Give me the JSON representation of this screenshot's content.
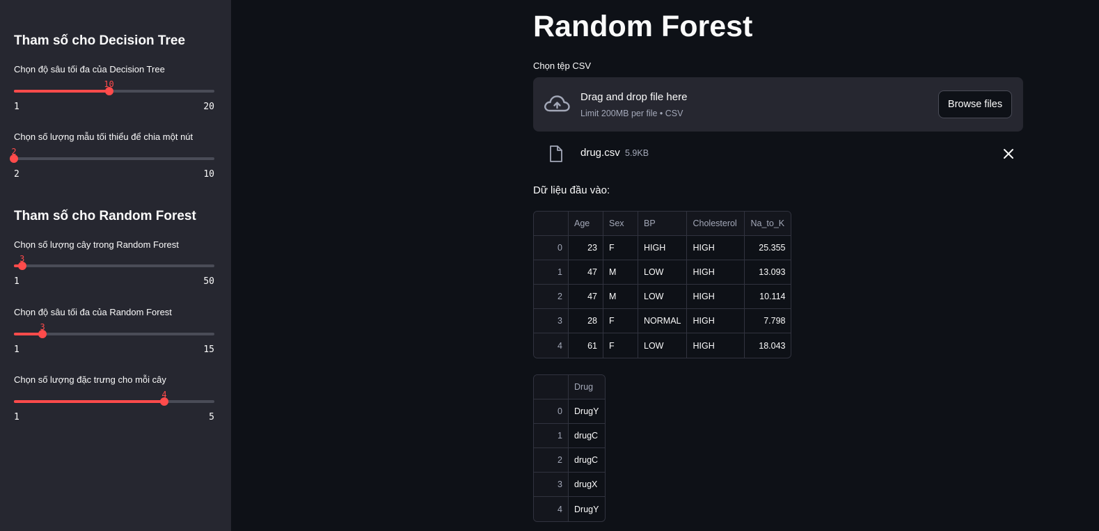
{
  "sidebar": {
    "dt_header": "Tham số cho Decision Tree",
    "rf_header": "Tham số cho Random Forest",
    "sliders": [
      {
        "label": "Chọn độ sâu tối đa của Decision Tree",
        "value": "10",
        "min": "1",
        "max": "20"
      },
      {
        "label": "Chọn số lượng mẫu tối thiểu để chia một nút",
        "value": "2",
        "min": "2",
        "max": "10"
      },
      {
        "label": "Chọn số lượng cây trong Random Forest",
        "value": "3",
        "min": "1",
        "max": "50"
      },
      {
        "label": "Chọn độ sâu tối đa của Random Forest",
        "value": "3",
        "min": "1",
        "max": "15"
      },
      {
        "label": "Chọn số lượng đặc trưng cho mỗi cây",
        "value": "4",
        "min": "1",
        "max": "5"
      }
    ]
  },
  "main": {
    "title": "Random Forest",
    "uploader": {
      "label": "Chọn tệp CSV",
      "drop_text": "Drag and drop file here",
      "limit_text": "Limit 200MB per file • CSV",
      "browse_label": "Browse files"
    },
    "file": {
      "name": "drug.csv",
      "size": "5.9KB"
    },
    "input_label": "Dữ liệu đầu vào:",
    "table_x": {
      "columns": [
        "",
        "Age",
        "Sex",
        "BP",
        "Cholesterol",
        "Na_to_K"
      ],
      "rows": [
        [
          "0",
          "23",
          "F",
          "HIGH",
          "HIGH",
          "25.355"
        ],
        [
          "1",
          "47",
          "M",
          "LOW",
          "HIGH",
          "13.093"
        ],
        [
          "2",
          "47",
          "M",
          "LOW",
          "HIGH",
          "10.114"
        ],
        [
          "3",
          "28",
          "F",
          "NORMAL",
          "HIGH",
          "7.798"
        ],
        [
          "4",
          "61",
          "F",
          "LOW",
          "HIGH",
          "18.043"
        ]
      ]
    },
    "table_y": {
      "columns": [
        "",
        "Drug"
      ],
      "rows": [
        [
          "0",
          "DrugY"
        ],
        [
          "1",
          "drugC"
        ],
        [
          "2",
          "drugC"
        ],
        [
          "3",
          "drugX"
        ],
        [
          "4",
          "DrugY"
        ]
      ]
    }
  },
  "colors": {
    "accent": "#ff4b4b",
    "sidebar_bg": "#262730",
    "main_bg": "#0e1117"
  },
  "icons": {
    "upload": "cloud-upload-icon",
    "file": "file-icon",
    "remove": "close-icon"
  }
}
